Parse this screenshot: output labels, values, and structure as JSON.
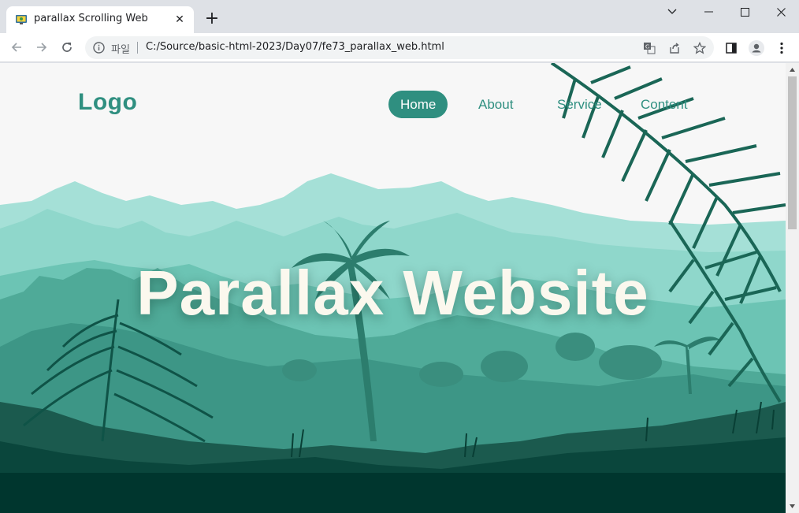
{
  "browser": {
    "tab_title": "parallax Scrolling Web",
    "address_scheme_label": "파일",
    "url": "C:/Source/basic-html-2023/Day07/fe73_parallax_web.html"
  },
  "page": {
    "logo": "Logo",
    "nav": [
      {
        "label": "Home",
        "active": true
      },
      {
        "label": "About",
        "active": false
      },
      {
        "label": "Service",
        "active": false
      },
      {
        "label": "Content",
        "active": false
      }
    ],
    "hero_title": "Parallax Website"
  },
  "colors": {
    "accent": "#2f8f80",
    "hero_text": "#fbf8ee",
    "foreground_dark": "#00362e"
  },
  "icons": [
    "site-favicon",
    "close-icon",
    "plus-icon",
    "chevron-down-icon",
    "minimize-icon",
    "maximize-icon",
    "window-close-icon",
    "back-arrow-icon",
    "forward-arrow-icon",
    "reload-icon",
    "info-icon",
    "translate-icon",
    "share-icon",
    "star-icon",
    "side-panel-icon",
    "profile-icon",
    "kebab-menu-icon"
  ]
}
